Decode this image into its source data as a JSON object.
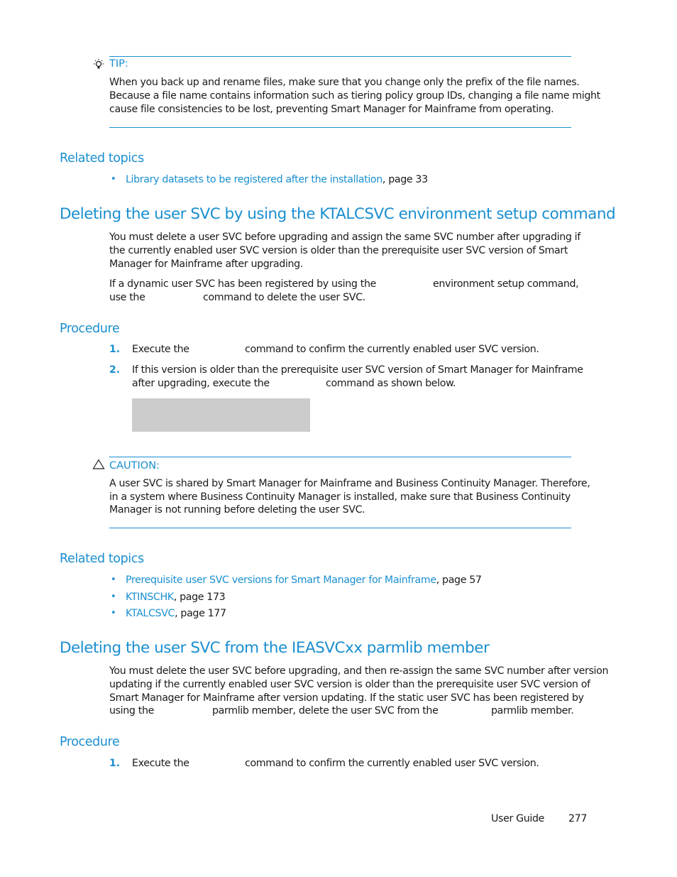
{
  "tip": {
    "label": "TIP:",
    "icon": "lightbulb-icon",
    "lines": [
      "When you back up and rename files, make sure that you change only the prefix of the file names.",
      "Because a file name contains information such as tiering policy group IDs, changing a file name might",
      "cause file consistencies to be lost, preventing Smart Manager for Mainframe from operating."
    ]
  },
  "related1": {
    "heading": "Related topics",
    "items": [
      {
        "link": "Library datasets to be registered after the installation",
        "page": ", page 33"
      }
    ]
  },
  "section1": {
    "heading": "Deleting the user SVC by using the KTALCSVC environment setup command",
    "para1": [
      "You must delete a user SVC before upgrading and assign the same SVC number after upgrading if",
      "the currently enabled user SVC version is older than the prerequisite user SVC version of Smart",
      "Manager for Mainframe after upgrading."
    ],
    "para2": {
      "l1a": "If a dynamic user SVC has been registered by using the",
      "l1b": "environment setup command,",
      "l2a": "use the",
      "l2b": "command to delete the user SVC."
    },
    "procedure": {
      "heading": "Procedure",
      "steps": [
        {
          "num": "1.",
          "a": "Execute the",
          "b": "command to confirm the currently enabled user SVC version."
        },
        {
          "num": "2.",
          "a": "If this version is older than the prerequisite user SVC version of Smart Manager for Mainframe",
          "c": "after upgrading, execute the",
          "b": "command as shown below."
        }
      ]
    }
  },
  "caution": {
    "label": "CAUTION:",
    "icon": "warning-triangle-icon",
    "lines": [
      "A user SVC is shared by Smart Manager for Mainframe and Business Continuity Manager. Therefore,",
      "in a system where Business Continuity Manager is installed, make sure that Business Continuity",
      "Manager is not running before deleting the user SVC."
    ]
  },
  "related2": {
    "heading": "Related topics",
    "items": [
      {
        "link": "Prerequisite user SVC versions for Smart Manager for Mainframe",
        "page": ", page 57"
      },
      {
        "link": "KTINSCHK",
        "page": ", page 173"
      },
      {
        "link": "KTALCSVC",
        "page": ", page 177"
      }
    ]
  },
  "section2": {
    "heading": "Deleting the user SVC from the IEASVCxx parmlib member",
    "lines": [
      "You must delete the user SVC before upgrading, and then re-assign the same SVC number after version",
      "updating if the currently enabled user SVC version is older than the prerequisite user SVC version of",
      "Smart Manager for Mainframe after version updating. If the static user SVC has been registered by"
    ],
    "l4a": "using the",
    "l4b": "parmlib member, delete the user SVC from the",
    "l4c": "parmlib member.",
    "procedure": {
      "heading": "Procedure",
      "steps": [
        {
          "num": "1.",
          "a": "Execute the",
          "b": "command to confirm the currently enabled user SVC version."
        }
      ]
    }
  },
  "footer": {
    "guide": "User Guide",
    "page": "277"
  }
}
